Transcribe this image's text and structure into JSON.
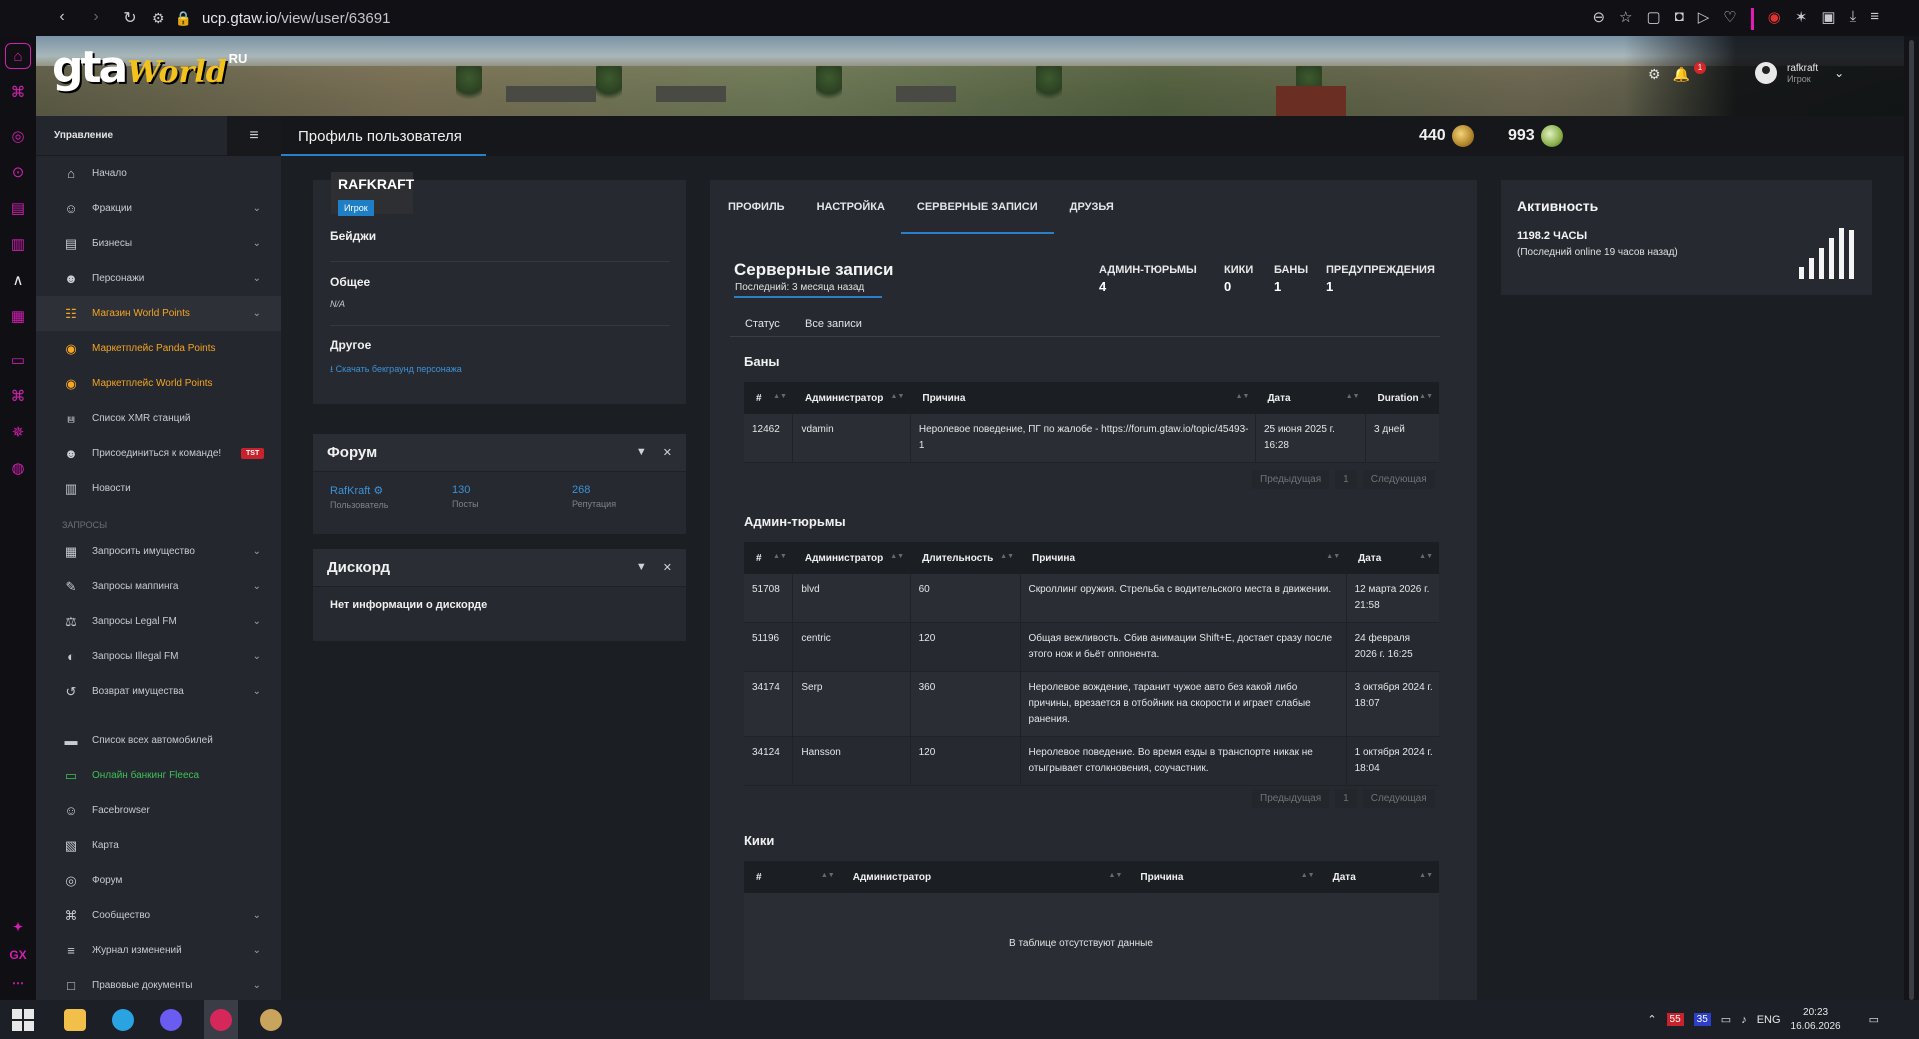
{
  "browser": {
    "url_host": "ucp.gtaw.io",
    "url_path": "/view/user/63691"
  },
  "header": {
    "logo_text": "gta",
    "logo_world": "World",
    "logo_ru": "RU",
    "notification_count": "1",
    "username": "rafkraft",
    "user_role": "Игрок"
  },
  "sidebar": {
    "title": "Управление",
    "items": [
      {
        "label": "Начало",
        "icon": "home-icon",
        "caret": false
      },
      {
        "label": "Фракции",
        "icon": "users-icon",
        "caret": true
      },
      {
        "label": "Бизнесы",
        "icon": "briefcase-icon",
        "caret": true
      },
      {
        "label": "Персонажи",
        "icon": "person-icon",
        "caret": true
      },
      {
        "label": "Магазин World Points",
        "icon": "cart-icon",
        "caret": true,
        "style": "orange"
      },
      {
        "label": "Маркетплейс Panda Points",
        "icon": "coins-icon",
        "caret": false,
        "style": "orange"
      },
      {
        "label": "Маркетплейс World Points",
        "icon": "coins-icon",
        "caret": false,
        "style": "orange"
      },
      {
        "label": "Список XMR станций",
        "icon": "antenna-icon",
        "caret": false
      },
      {
        "label": "Присоединиться к команде!",
        "icon": "person-plus-icon",
        "caret": false,
        "tag": "TST"
      },
      {
        "label": "Новости",
        "icon": "newspaper-icon",
        "caret": false
      }
    ],
    "section_label": "ЗАПРОСЫ",
    "request_items": [
      {
        "label": "Запросить имущество",
        "icon": "building-icon",
        "caret": true
      },
      {
        "label": "Запросы маппинга",
        "icon": "brush-icon",
        "caret": true
      },
      {
        "label": "Запросы Legal FM",
        "icon": "scale-icon",
        "caret": true
      },
      {
        "label": "Запросы Illegal FM",
        "icon": "mask-icon",
        "caret": true
      },
      {
        "label": "Возврат имущества",
        "icon": "undo-icon",
        "caret": true
      }
    ],
    "other_items": [
      {
        "label": "Список всех автомобилей",
        "icon": "car-icon",
        "caret": false
      },
      {
        "label": "Онлайн банкинг Fleeca",
        "icon": "bank-card-icon",
        "caret": false,
        "style": "green"
      },
      {
        "label": "Facebrowser",
        "icon": "people-icon",
        "caret": false
      },
      {
        "label": "Карта",
        "icon": "map-icon",
        "caret": false
      },
      {
        "label": "Форум",
        "icon": "chat-icon",
        "caret": false
      },
      {
        "label": "Сообщество",
        "icon": "share-icon",
        "caret": true
      },
      {
        "label": "Журнал изменений",
        "icon": "list-icon",
        "caret": true
      },
      {
        "label": "Правовые документы",
        "icon": "doc-icon",
        "caret": true
      }
    ]
  },
  "page": {
    "title": "Профиль пользователя",
    "points_world": "440",
    "points_panda": "993"
  },
  "profile": {
    "name": "RAFKRAFT",
    "role": "Игрок",
    "badges_label": "Бейджи",
    "general_label": "Общее",
    "general_value": "N/A",
    "other_label": "Другое",
    "download_link": "Скачать бекграунд персонажа"
  },
  "forum": {
    "title": "Форум",
    "user_value": "RafKraft",
    "user_label": "Пользователь",
    "posts_value": "130",
    "posts_label": "Посты",
    "rep_value": "268",
    "rep_label": "Репутация"
  },
  "discord": {
    "title": "Дискорд",
    "text": "Нет информации о дискорде"
  },
  "tabs": [
    "ПРОФИЛЬ",
    "НАСТРОЙКА",
    "СЕРВЕРНЫЕ ЗАПИСИ",
    "ДРУЗЬЯ"
  ],
  "records": {
    "title": "Серверные записи",
    "last": "Последний: 3 месяца назад",
    "stats": [
      {
        "label": "АДМИН-ТЮРЬМЫ",
        "value": "4"
      },
      {
        "label": "КИКИ",
        "value": "0"
      },
      {
        "label": "БАНЫ",
        "value": "1"
      },
      {
        "label": "ПРЕДУПРЕЖДЕНИЯ",
        "value": "1"
      }
    ],
    "subtabs": [
      "Статус",
      "Все записи"
    ]
  },
  "bans": {
    "title": "Баны",
    "headers": [
      "#",
      "Администратор",
      "Причина",
      "Дата",
      "Duration"
    ],
    "rows": [
      [
        "12462",
        "vdamin",
        "Неролевое поведение, ПГ по жалобе - https://forum.gtaw.io/topic/45493-1",
        "25 июня 2025 г. 16:28",
        "3 дней"
      ]
    ]
  },
  "jails": {
    "title": "Админ-тюрьмы",
    "headers": [
      "#",
      "Администратор",
      "Длительность",
      "Причина",
      "Дата"
    ],
    "rows": [
      [
        "51708",
        "blvd",
        "60",
        "Скроллинг оружия. Стрельба с водительского места в движении.",
        "12 марта 2026 г. 21:58"
      ],
      [
        "51196",
        "centric",
        "120",
        "Общая вежливость. Сбив анимации Shift+E, достает сразу после этого нож и бьёт оппонента.",
        "24 февраля 2026 г. 16:25"
      ],
      [
        "34174",
        "Serp",
        "360",
        "Неролевое вождение, таранит чужое авто без какой либо причины, врезается в отбойник на скорости и играет слабые ранения.",
        "3 октября 2024 г. 18:07"
      ],
      [
        "34124",
        "Hansson",
        "120",
        "Неролевое поведение. Во время езды в транспорте никак не отыгрывает столкновения, соучастник.",
        "1 октября 2024 г. 18:04"
      ]
    ]
  },
  "kicks": {
    "title": "Кики",
    "headers": [
      "#",
      "Администратор",
      "Причина",
      "Дата"
    ],
    "empty": "В таблице отсутствуют данные"
  },
  "pager": {
    "prev": "Предыдущая",
    "page": "1",
    "next": "Следующая"
  },
  "activity": {
    "title": "Активность",
    "hours": "1198.2 ЧАСЫ",
    "last_online": "(Последний online 19 часов назад)"
  },
  "taskbar": {
    "lang": "ENG",
    "time": "20:23",
    "date": "16.06.2026",
    "tray_num_red": "55",
    "tray_num_blue": "35"
  }
}
